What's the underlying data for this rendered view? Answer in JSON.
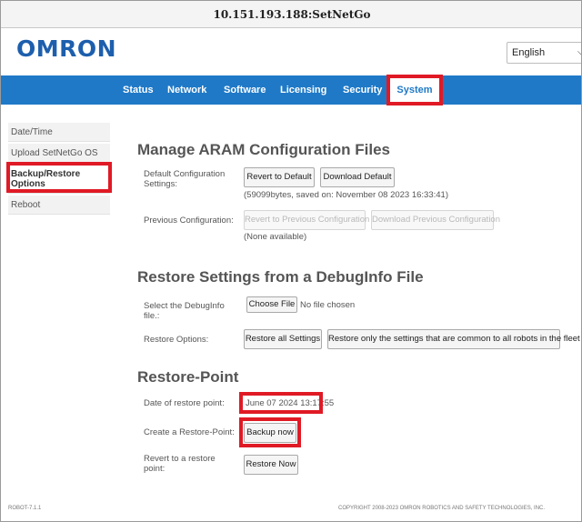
{
  "window": {
    "title": "10.151.193.188:SetNetGo"
  },
  "header": {
    "logo": "OMRON",
    "language": {
      "selected": "English"
    }
  },
  "nav": {
    "items": [
      {
        "label": "Status"
      },
      {
        "label": "Network"
      },
      {
        "label": "Software"
      },
      {
        "label": "Licensing"
      },
      {
        "label": "Security"
      },
      {
        "label": "System",
        "active": true
      }
    ]
  },
  "sidebar": {
    "items": [
      {
        "label": "Date/Time"
      },
      {
        "label": "Upload SetNetGo OS"
      },
      {
        "label": "Backup/Restore Options",
        "active": true
      },
      {
        "label": "Reboot"
      }
    ]
  },
  "aram": {
    "heading": "Manage ARAM Configuration Files",
    "default_label": "Default Configuration Settings:",
    "revert_default": "Revert to Default",
    "download_default": "Download Default",
    "default_note": "(59099bytes, saved on: November 08 2023 16:33:41)",
    "previous_label": "Previous Configuration:",
    "revert_previous": "Revert to Previous Configuration",
    "download_previous": "Download Previous Configuration",
    "previous_note": "(None available)"
  },
  "debuginfo": {
    "heading": "Restore Settings from a DebugInfo File",
    "select_label": "Select the DebugInfo file.:",
    "choose_file": "Choose File",
    "no_file": "No file chosen",
    "options_label": "Restore Options:",
    "restore_all": "Restore all Settings",
    "restore_common": "Restore only the settings that are common to all robots in the fleet"
  },
  "restore_point": {
    "heading": "Restore-Point",
    "date_label": "Date of restore point:",
    "date_value": "June 07 2024 13:17:55",
    "create_label": "Create a Restore-Point:",
    "backup_now": "Backup now",
    "revert_label": "Revert to a restore point:",
    "restore_now": "Restore Now"
  },
  "footer": {
    "version": "ROBOT-7.1.1",
    "copyright": "COPYRIGHT 2008-2023 OMRON ROBOTICS AND SAFETY TECHNOLOGIES, INC."
  },
  "colors": {
    "brand_blue": "#1f79c7",
    "logo_blue": "#1d5fad",
    "highlight_red": "#e01a25"
  }
}
